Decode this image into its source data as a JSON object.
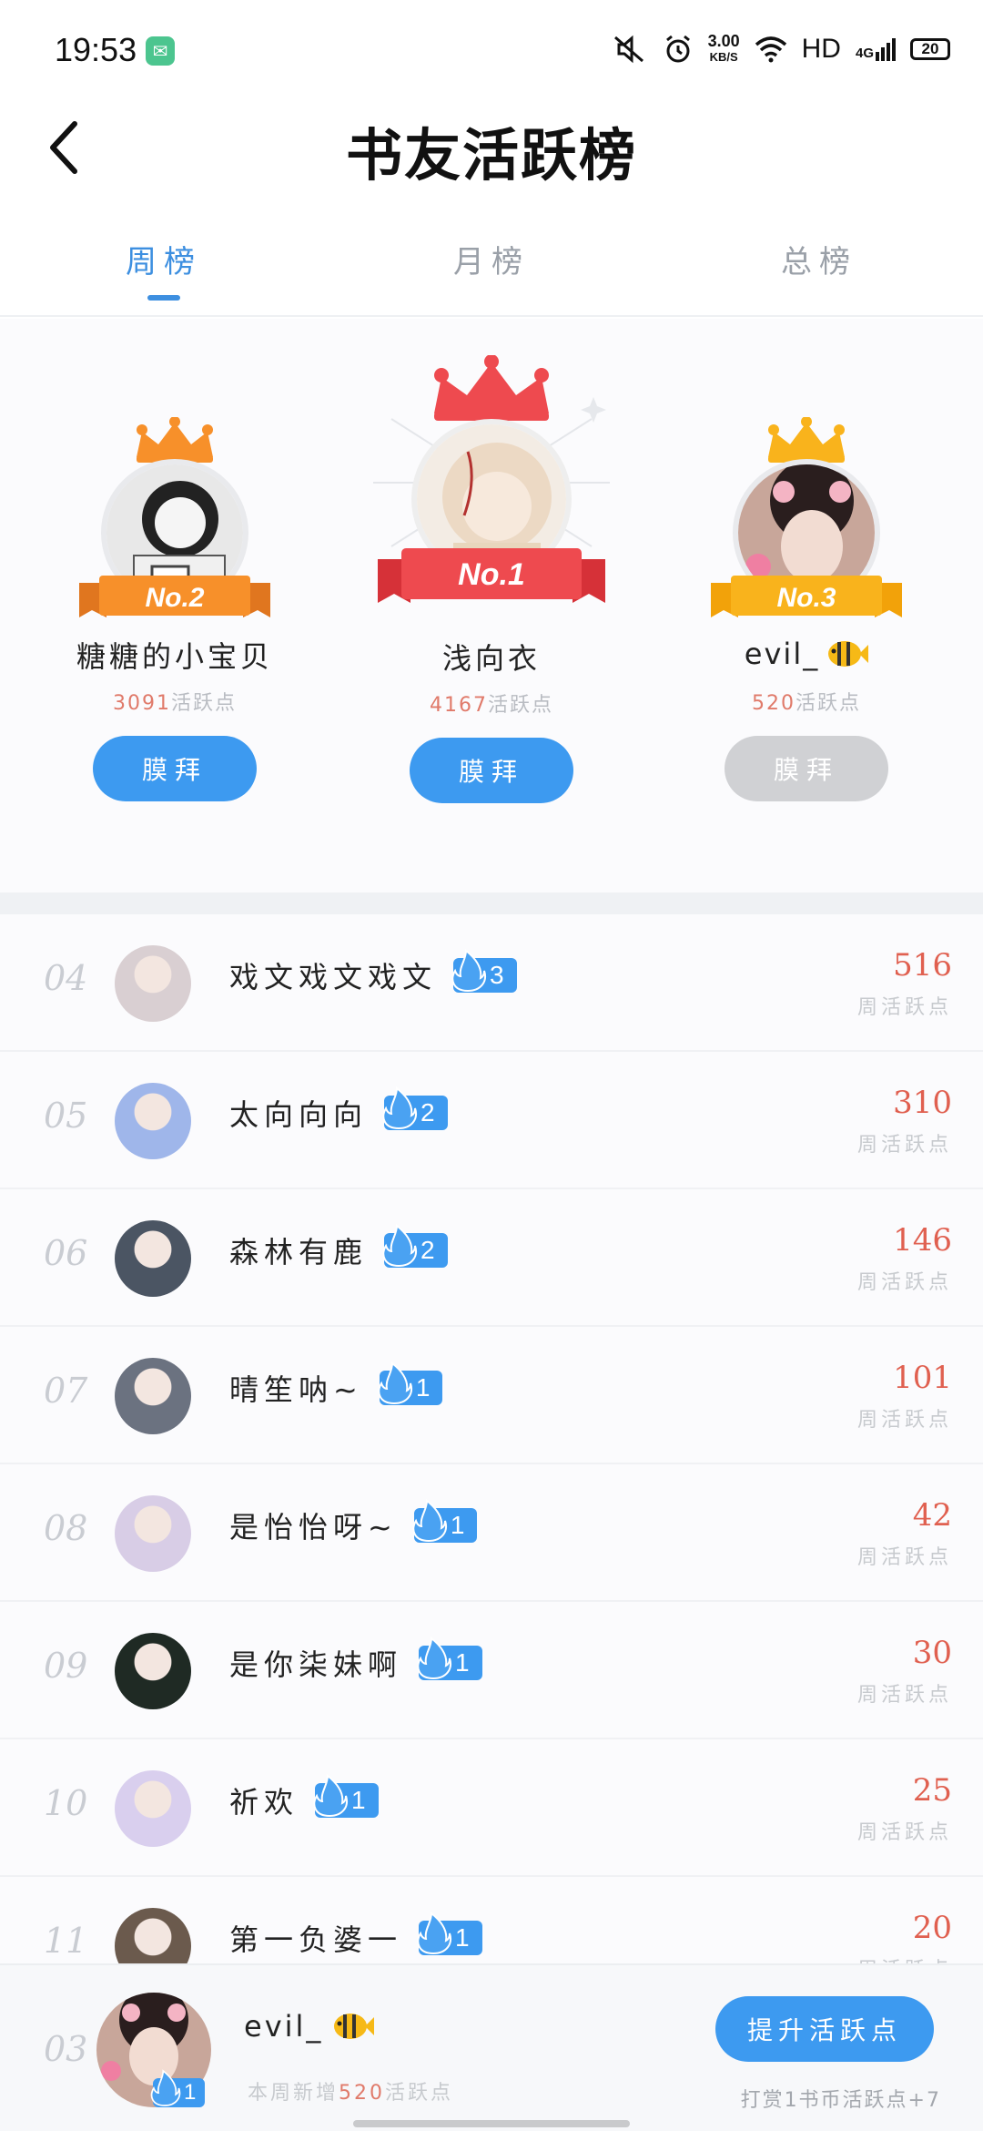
{
  "status_bar": {
    "time": "19:53",
    "speed_value": "3.00",
    "speed_unit": "KB/S",
    "hd": "HD",
    "network": "4G",
    "battery": "20"
  },
  "header": {
    "title": "书友活跃榜"
  },
  "tabs": [
    {
      "label": "周榜",
      "active": true
    },
    {
      "label": "月榜",
      "active": false
    },
    {
      "label": "总榜",
      "active": false
    }
  ],
  "podium": {
    "first": {
      "rank_label": "No.1",
      "name": "浅向衣",
      "points": "4167",
      "points_unit": "活跃点",
      "button": "膜拜",
      "crown_color": "#ee4a4f"
    },
    "second": {
      "rank_label": "No.2",
      "name": "糖糖的小宝贝",
      "points": "3091",
      "points_unit": "活跃点",
      "button": "膜拜",
      "crown_color": "#f7902a"
    },
    "third": {
      "rank_label": "No.3",
      "name": "evil_",
      "points": "520",
      "points_unit": "活跃点",
      "button": "膜拜",
      "crown_color": "#f9b31c"
    }
  },
  "list": [
    {
      "rank": "04",
      "name": "戏文戏文戏文",
      "fire": "3",
      "score": "516",
      "score_label": "周活跃点",
      "avatar_color": "#d9cfd2"
    },
    {
      "rank": "05",
      "name": "太向向向",
      "fire": "2",
      "score": "310",
      "score_label": "周活跃点",
      "avatar_color": "#9fb6ea"
    },
    {
      "rank": "06",
      "name": "森林有鹿",
      "fire": "2",
      "score": "146",
      "score_label": "周活跃点",
      "avatar_color": "#4b5563"
    },
    {
      "rank": "07",
      "name": "晴笙呐~",
      "fire": "1",
      "score": "101",
      "score_label": "周活跃点",
      "avatar_color": "#6b7280"
    },
    {
      "rank": "08",
      "name": "是怡怡呀~",
      "fire": "1",
      "score": "42",
      "score_label": "周活跃点",
      "avatar_color": "#d8cde6"
    },
    {
      "rank": "09",
      "name": "是你柒妹啊",
      "fire": "1",
      "score": "30",
      "score_label": "周活跃点",
      "avatar_color": "#1f2a24"
    },
    {
      "rank": "10",
      "name": "祈欢",
      "fire": "1",
      "score": "25",
      "score_label": "周活跃点",
      "avatar_color": "#d9cfee"
    },
    {
      "rank": "11",
      "name": "第一负婆一",
      "fire": "1",
      "score": "20",
      "score_label": "周活跃点",
      "avatar_color": "#6b5a4d"
    }
  ],
  "me": {
    "rank": "03",
    "name": "evil_",
    "fire": "1",
    "note_prefix": "本周新增",
    "note_value": "520",
    "note_suffix": "活跃点",
    "boost_button": "提升活跃点",
    "tip": "打赏1书币活跃点+7"
  }
}
